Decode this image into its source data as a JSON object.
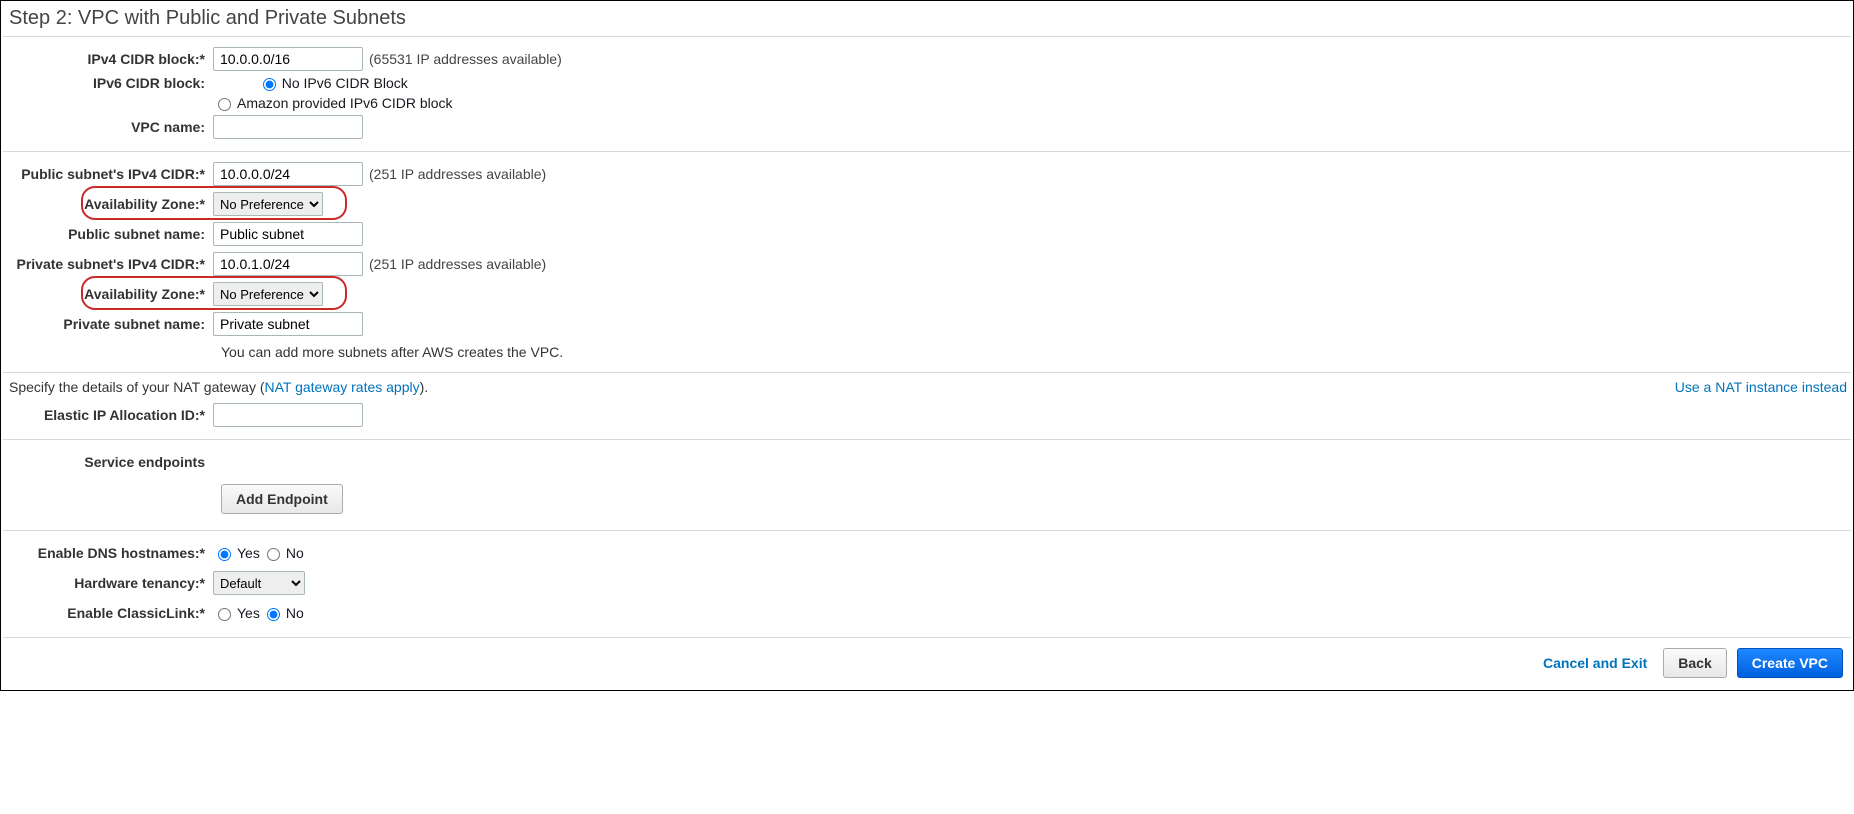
{
  "header": {
    "title": "Step 2: VPC with Public and Private Subnets"
  },
  "ipv4_cidr": {
    "label": "IPv4 CIDR block:*",
    "value": "10.0.0.0/16",
    "hint": "(65531 IP addresses available)"
  },
  "ipv6_cidr": {
    "label": "IPv6 CIDR block:",
    "no_ipv6": "No IPv6 CIDR Block",
    "amazon_ipv6": "Amazon provided IPv6 CIDR block"
  },
  "vpc_name": {
    "label": "VPC name:",
    "value": ""
  },
  "public_subnet_cidr": {
    "label": "Public subnet's IPv4 CIDR:*",
    "value": "10.0.0.0/24",
    "hint": "(251 IP addresses available)"
  },
  "public_az": {
    "label": "Availability Zone:*",
    "selected": "No Preference"
  },
  "public_subnet_name": {
    "label": "Public subnet name:",
    "value": "Public subnet"
  },
  "private_subnet_cidr": {
    "label": "Private subnet's IPv4 CIDR:*",
    "value": "10.0.1.0/24",
    "hint": "(251 IP addresses available)"
  },
  "private_az": {
    "label": "Availability Zone:*",
    "selected": "No Preference"
  },
  "private_subnet_name": {
    "label": "Private subnet name:",
    "value": "Private subnet"
  },
  "more_subnets_note": "You can add more subnets after AWS creates the VPC.",
  "nat": {
    "prefix": "Specify the details of your NAT gateway (",
    "link": "NAT gateway rates apply",
    "suffix": ").",
    "instance_link": "Use a NAT instance instead"
  },
  "elastic_ip": {
    "label": "Elastic IP Allocation ID:*",
    "value": ""
  },
  "service_endpoints": {
    "label": "Service endpoints",
    "button": "Add Endpoint"
  },
  "dns_hostnames": {
    "label": "Enable DNS hostnames:*",
    "yes": "Yes",
    "no": "No"
  },
  "hardware_tenancy": {
    "label": "Hardware tenancy:*",
    "selected": "Default"
  },
  "classiclink": {
    "label": "Enable ClassicLink:*",
    "yes": "Yes",
    "no": "No"
  },
  "footer": {
    "cancel": "Cancel and Exit",
    "back": "Back",
    "create": "Create VPC"
  }
}
